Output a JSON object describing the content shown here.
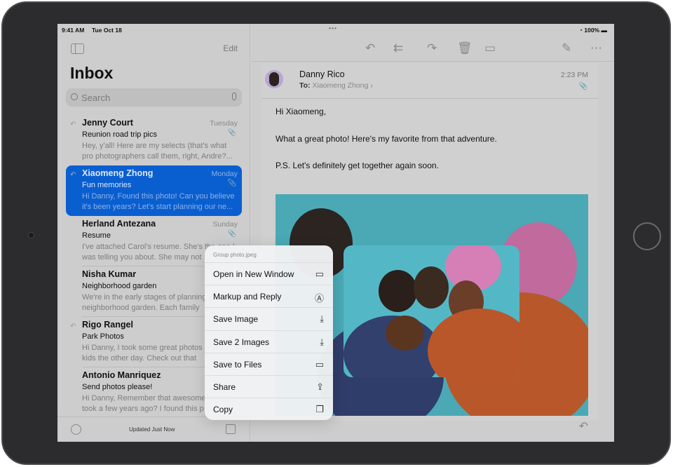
{
  "status": {
    "time": "9:41 AM",
    "date": "Tue Oct 18",
    "battery": "100%"
  },
  "sidebar": {
    "edit": "Edit",
    "title": "Inbox",
    "search_placeholder": "Search",
    "footer_status": "Updated Just Now",
    "messages": [
      {
        "name": "Jenny Court",
        "date": "Tuesday",
        "subject": "Reunion road trip pics",
        "preview": "Hey, y'all! Here are my selects (that's what pro photographers call them, right, Andre?...",
        "replied": true
      },
      {
        "name": "Xiaomeng Zhong",
        "date": "Monday",
        "subject": "Fun memories",
        "preview": "Hi Danny, Found this photo! Can you believe it's been years? Let's start planning our ne...",
        "replied": true
      },
      {
        "name": "Herland Antezana",
        "date": "Sunday",
        "subject": "Resume",
        "preview": "I've attached Carol's resume. She's the one I was telling you about. She may not",
        "replied": false
      },
      {
        "name": "Nisha Kumar",
        "date": "",
        "subject": "Neighborhood garden",
        "preview": "We're in the early stages of planning a neighborhood garden. Each family",
        "replied": false
      },
      {
        "name": "Rigo Rangel",
        "date": "",
        "subject": "Park Photos",
        "preview": "Hi Danny, I took some great photos of the kids the other day. Check out that",
        "replied": true
      },
      {
        "name": "Antonio Manriquez",
        "date": "",
        "subject": "Send photos please!",
        "preview": "Hi Danny, Remember that awesome trip we took a few years ago? I found this p",
        "replied": false
      }
    ]
  },
  "message": {
    "from": "Danny Rico",
    "to_label": "To:",
    "to": "Xiaomeng Zhong ›",
    "time": "2:23 PM",
    "body": [
      "Hi Xiaomeng,",
      "What a great photo! Here's my favorite from that adventure.",
      "P.S. Let's definitely get together again soon."
    ]
  },
  "context_menu": {
    "title": "Group photo.jpeg",
    "items": [
      {
        "label": "Open in New Window",
        "icon": "▭"
      },
      {
        "label": "Markup and Reply",
        "icon": "Ⓐ"
      },
      {
        "label": "Save Image",
        "icon": "⤓"
      },
      {
        "label": "Save 2 Images",
        "icon": "⤓"
      },
      {
        "label": "Save to Files",
        "icon": "▭"
      },
      {
        "label": "Share",
        "icon": "⇪"
      },
      {
        "label": "Copy",
        "icon": "❐"
      }
    ]
  }
}
